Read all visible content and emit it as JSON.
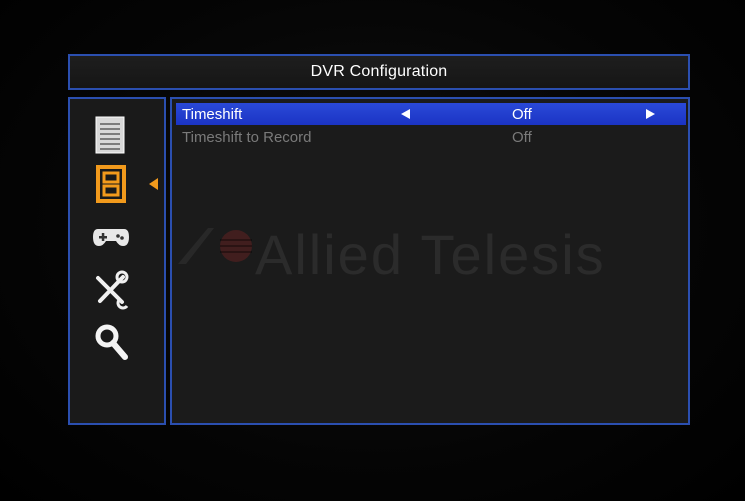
{
  "header": {
    "title": "DVR Configuration"
  },
  "sidebar": {
    "items": [
      {
        "icon": "document-icon",
        "selected": false
      },
      {
        "icon": "film-icon",
        "selected": true,
        "accent": "#f29a1c"
      },
      {
        "icon": "gamepad-icon",
        "selected": false
      },
      {
        "icon": "tools-icon",
        "selected": false
      },
      {
        "icon": "search-icon",
        "selected": false
      }
    ]
  },
  "settings": {
    "rows": [
      {
        "label": "Timeshift",
        "value": "Off",
        "selected": true
      },
      {
        "label": "Timeshift to Record",
        "value": "Off",
        "selected": false
      }
    ]
  },
  "watermark": {
    "text": "Allied Telesis"
  },
  "colors": {
    "border": "#2b4fb0",
    "selection": "#2a49d8",
    "accent": "#f29a1c",
    "disabled_text": "#7a7a7a"
  }
}
